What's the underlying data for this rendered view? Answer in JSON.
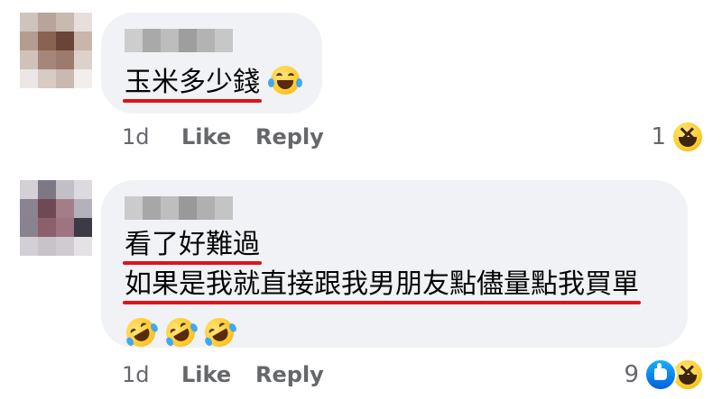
{
  "comments": [
    {
      "text_lines": [
        "玉米多少錢"
      ],
      "emoji": [
        "joy"
      ],
      "time": "1d",
      "like_label": "Like",
      "reply_label": "Reply",
      "reaction_count": "1",
      "reactions": [
        "haha"
      ]
    },
    {
      "text_lines": [
        "看了好難過",
        "如果是我就直接跟我男朋友點儘量點我買單"
      ],
      "emoji": [
        "rolling-on-floor-laughing",
        "rolling-on-floor-laughing",
        "rolling-on-floor-laughing"
      ],
      "time": "1d",
      "like_label": "Like",
      "reply_label": "Reply",
      "reaction_count": "9",
      "reactions": [
        "like",
        "haha"
      ]
    }
  ],
  "colors": {
    "bubble": "#f0f2f5",
    "underline": "#e0121a",
    "meta_text": "#65676b",
    "like_blue": "#0062df"
  }
}
